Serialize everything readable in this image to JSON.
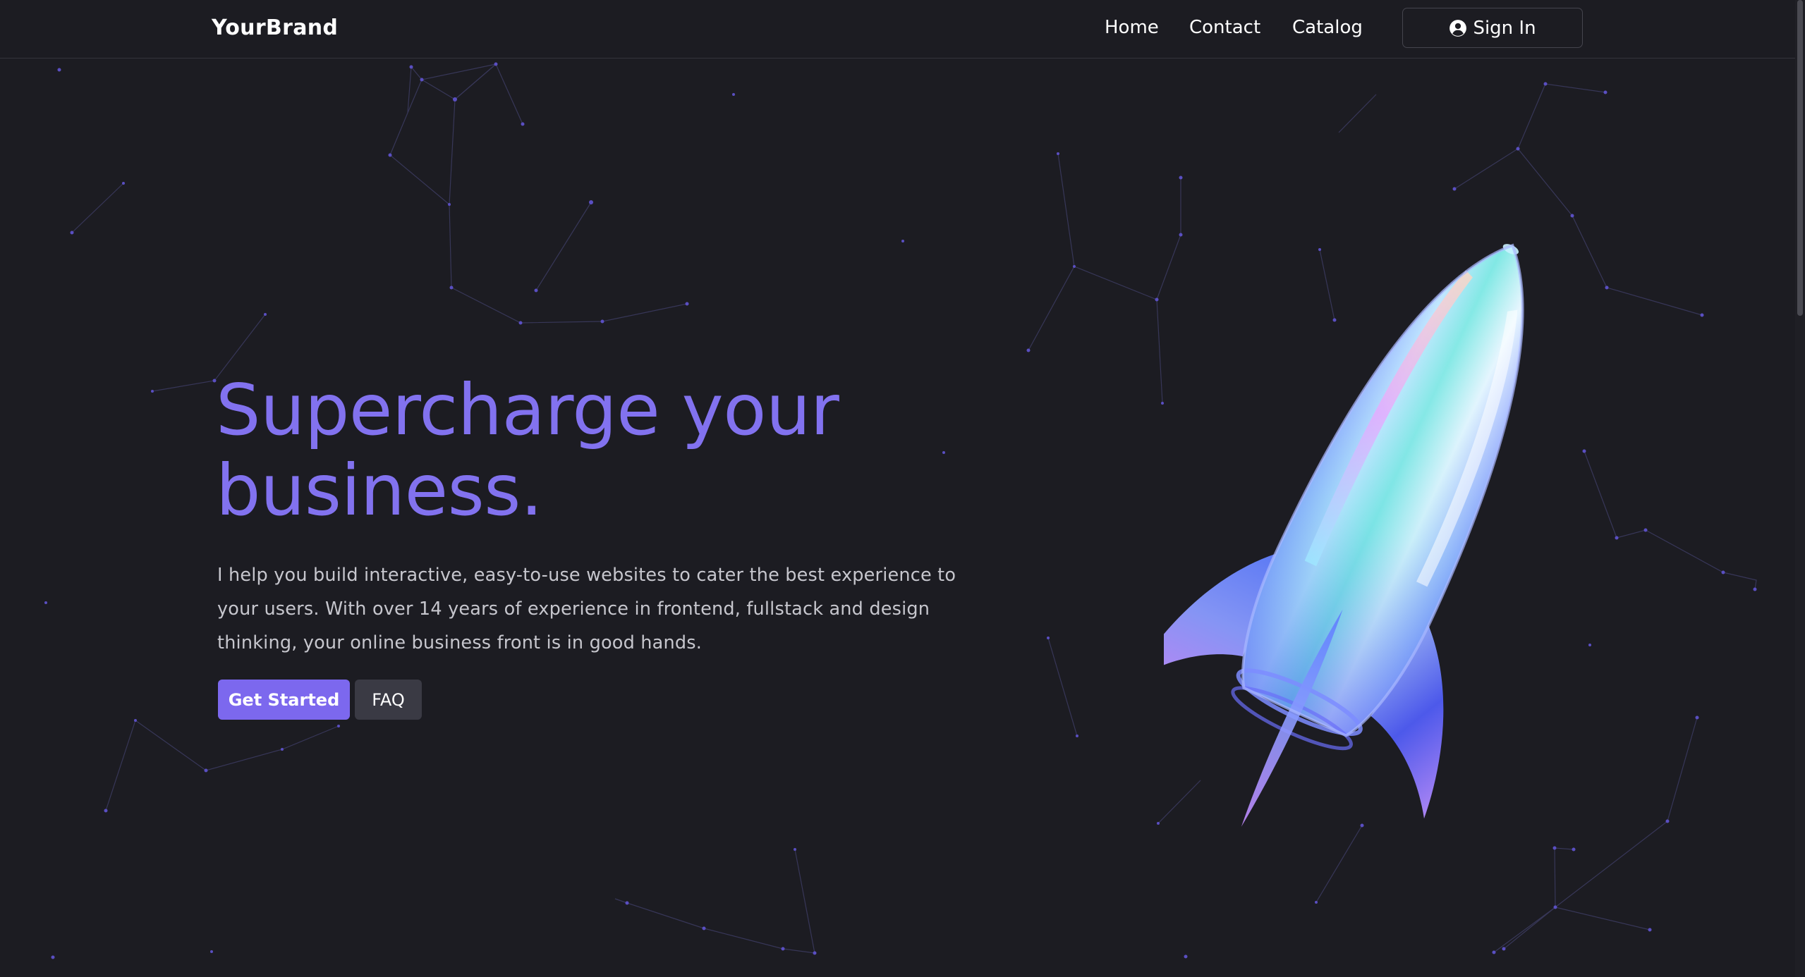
{
  "header": {
    "brand": "YourBrand",
    "nav": [
      "Home",
      "Contact",
      "Catalog"
    ],
    "sign_in_label": "Sign In",
    "sign_in_icon": "user-circle-icon"
  },
  "hero": {
    "headline_line1": "Supercharge your",
    "headline_line2": "business.",
    "description": "I help you build interactive, easy-to-use websites to cater the best experience to your users. With over 14 years of experience in frontend, fullstack and design thinking, your online business front is in good hands.",
    "primary_button": "Get Started",
    "secondary_button": "FAQ",
    "illustration": "glass-rocket"
  },
  "colors": {
    "background": "#1c1c22",
    "accent": "#7c68ee",
    "headline": "#8272ef",
    "secondary_button": "#3a3a44",
    "particle": "#6b5fd8"
  }
}
